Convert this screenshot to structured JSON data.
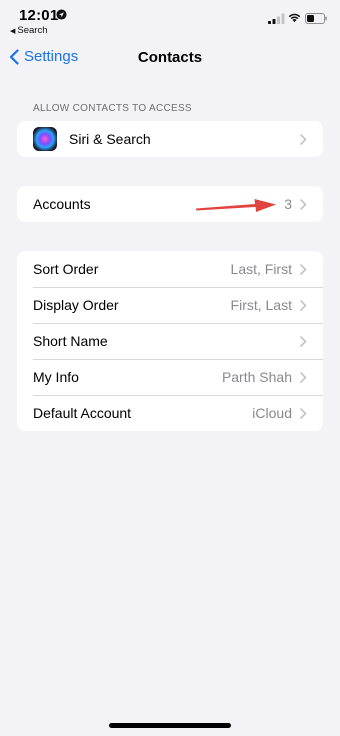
{
  "status": {
    "time": "12:01",
    "back_app": "Search"
  },
  "nav": {
    "back_label": "Settings",
    "title": "Contacts"
  },
  "section_header": "ALLOW CONTACTS TO ACCESS",
  "siri": {
    "label": "Siri & Search"
  },
  "accounts": {
    "label": "Accounts",
    "value": "3"
  },
  "settings": [
    {
      "label": "Sort Order",
      "value": "Last, First"
    },
    {
      "label": "Display Order",
      "value": "First, Last"
    },
    {
      "label": "Short Name",
      "value": ""
    },
    {
      "label": "My Info",
      "value": "Parth Shah"
    },
    {
      "label": "Default Account",
      "value": "iCloud"
    }
  ],
  "colors": {
    "accent": "#1a73e8",
    "background": "#f2f2f7",
    "annotation_arrow": "#e0443e"
  }
}
